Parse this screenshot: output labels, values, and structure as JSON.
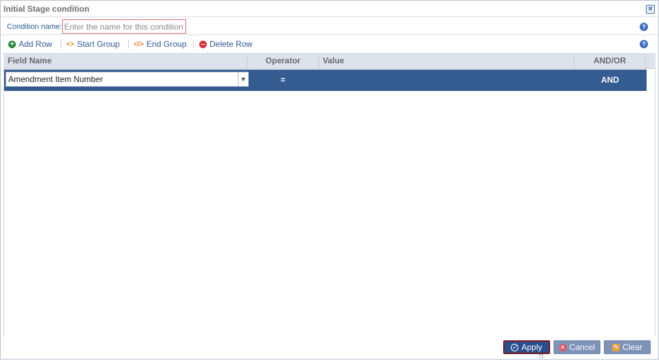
{
  "dialog": {
    "title": "Initial Stage condition",
    "close_icon": "close-icon"
  },
  "condition_name": {
    "label": "Condition name:",
    "placeholder": "Enter the name for this condition",
    "value": ""
  },
  "toolbar": {
    "add_row": "Add Row",
    "start_group": "Start Group",
    "end_group": "End Group",
    "delete_row": "Delete Row",
    "colors": {
      "add": "#2e8b3d",
      "group": "#e57f1f",
      "delete": "#d9363e"
    }
  },
  "grid": {
    "columns": [
      "Field Name",
      "Operator",
      "Value",
      "AND/OR"
    ],
    "rows": [
      {
        "field": "Amendment Item Number",
        "operator": "=",
        "value": "",
        "and_or": "AND"
      }
    ],
    "selected_row_color": "#345c91"
  },
  "footer": {
    "apply": "Apply",
    "cancel": "Cancel",
    "clear": "Clear"
  }
}
